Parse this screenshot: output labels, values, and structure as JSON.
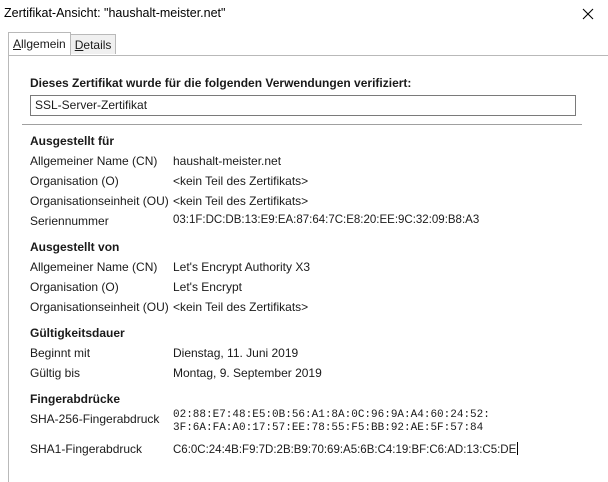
{
  "window": {
    "title": "Zertifikat-Ansicht: \"haushalt-meister.net\""
  },
  "tabs": [
    {
      "label": "Allgemein",
      "accel": "A",
      "rest": "llgemein",
      "active": true
    },
    {
      "label": "Details",
      "accel": "D",
      "rest": "etails",
      "active": false
    }
  ],
  "usage": {
    "heading": "Dieses Zertifikat wurde für die folgenden Verwendungen verifiziert:",
    "value": "SSL-Server-Zertifikat"
  },
  "issued_to": {
    "heading": "Ausgestellt für",
    "rows": [
      {
        "label": "Allgemeiner Name (CN)",
        "value": "haushalt-meister.net"
      },
      {
        "label": "Organisation (O)",
        "value": "<kein Teil des Zertifikats>"
      },
      {
        "label": "Organisationseinheit (OU)",
        "value": "<kein Teil des Zertifikats>"
      },
      {
        "label": "Seriennummer",
        "value": "03:1F:DC:DB:13:E9:EA:87:64:7C:E8:20:EE:9C:32:09:B8:A3"
      }
    ]
  },
  "issued_by": {
    "heading": "Ausgestellt von",
    "rows": [
      {
        "label": "Allgemeiner Name (CN)",
        "value": "Let's Encrypt Authority X3"
      },
      {
        "label": "Organisation (O)",
        "value": "Let's Encrypt"
      },
      {
        "label": "Organisationseinheit (OU)",
        "value": "<kein Teil des Zertifikats>"
      }
    ]
  },
  "validity": {
    "heading": "Gültigkeitsdauer",
    "rows": [
      {
        "label": "Beginnt mit",
        "value": "Dienstag, 11. Juni 2019"
      },
      {
        "label": "Gültig bis",
        "value": "Montag, 9. September 2019"
      }
    ]
  },
  "fingerprints": {
    "heading": "Fingerabdrücke",
    "sha256_label": "SHA-256-Fingerabdruck",
    "sha256_line1": "02:88:E7:48:E5:0B:56:A1:8A:0C:96:9A:A4:60:24:52:",
    "sha256_line2": "3F:6A:FA:A0:17:57:EE:78:55:F5:BB:92:AE:5F:57:84",
    "sha1_label": "SHA1-Fingerabdruck",
    "sha1_value": "C6:0C:24:4B:F9:7D:2B:B9:70:69:A5:6B:C4:19:BF:C6:AD:13:C5:DE"
  },
  "icons": {
    "close": "close-icon"
  }
}
